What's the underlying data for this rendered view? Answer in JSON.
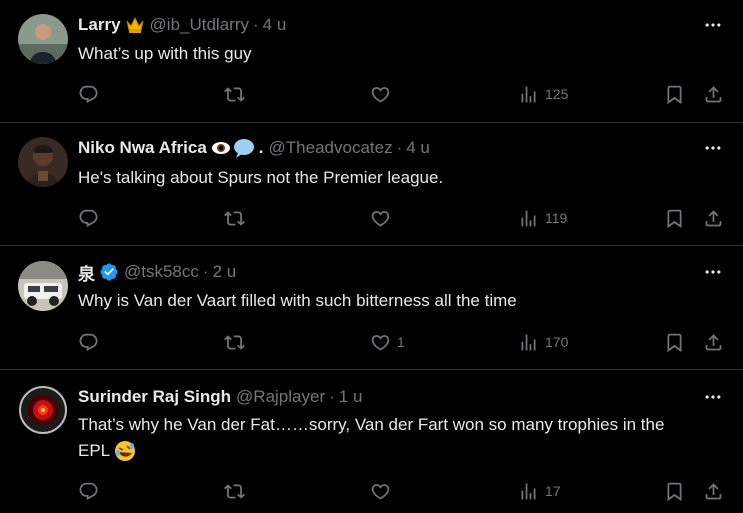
{
  "tweets": [
    {
      "display_name": "Larry",
      "badge_icon": "crown-emoji",
      "handle": "@ib_Utdlarry",
      "separator": "·",
      "time": "4 u",
      "text": "What’s up with this guy",
      "reply_count": "",
      "retweet_count": "",
      "like_count": "",
      "view_count": "125"
    },
    {
      "display_name": "Niko Nwa Africa",
      "badge_icon": "eye-in-speech-bubble-emoji",
      "badge_text": ".",
      "handle": "@Theadvocatez",
      "separator": "·",
      "time": "4 u",
      "text": "He's talking about Spurs not the Premier league.",
      "reply_count": "",
      "retweet_count": "",
      "like_count": "",
      "view_count": "119"
    },
    {
      "display_name": "泉",
      "badge_icon": "verified-badge",
      "handle": "@tsk58cc",
      "separator": "·",
      "time": "2 u",
      "text": "Why is Van der Vaart filled with such bitterness all the time",
      "reply_count": "",
      "retweet_count": "",
      "like_count": "1",
      "view_count": "170"
    },
    {
      "display_name": "Surinder Raj Singh",
      "handle": "@Rajplayer",
      "separator": "·",
      "time": "1 u",
      "text_line1": "That’s why he Van der Fat……sorry, Van der Fart won so many trophies in the",
      "text_line2": "EPL",
      "text_emoji": "rolling-on-floor-laughing-emoji",
      "reply_count": "",
      "retweet_count": "",
      "like_count": "",
      "view_count": "17"
    }
  ],
  "colors": {
    "background": "#000000",
    "text": "#e7e9ea",
    "muted": "#71767b",
    "divider": "#2f3336",
    "verified": "#1d9bf0"
  }
}
